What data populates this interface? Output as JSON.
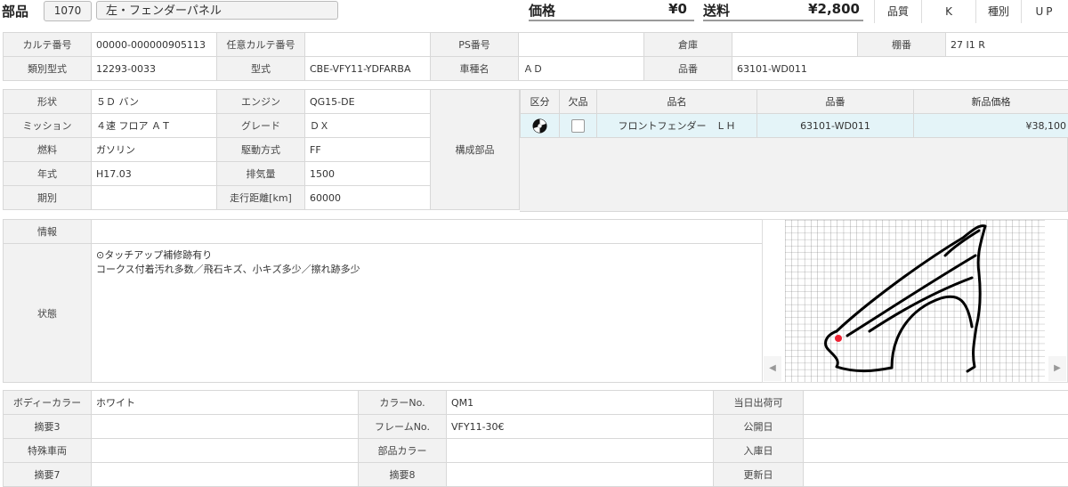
{
  "header": {
    "title": "部品",
    "code": "1070",
    "part_name": "左・フェンダーパネル",
    "price_label": "価格",
    "price_value": "¥0",
    "shipping_label": "送料",
    "shipping_value": "¥2,800",
    "quality_label": "品質",
    "quality_value": "K",
    "type_label": "種別",
    "type_value": "UP"
  },
  "row1": [
    {
      "label": "カルテ番号",
      "value": "00000-000000905113"
    },
    {
      "label": "任意カルテ番号",
      "value": ""
    },
    {
      "label": "PS番号",
      "value": ""
    },
    {
      "label": "倉庫",
      "value": ""
    },
    {
      "label": "棚番",
      "value": "27 I1 R"
    }
  ],
  "row2": [
    {
      "label": "類別型式",
      "value": "12293-0033"
    },
    {
      "label": "型式",
      "value": "CBE-VFY11-YDFARBA"
    },
    {
      "label": "車種名",
      "value": "ＡＤ"
    },
    {
      "label": "品番",
      "value": "63101-WD011"
    }
  ],
  "vehicle": [
    {
      "l1": "形状",
      "v1": "５Ｄ バン",
      "l2": "エンジン",
      "v2": "QG15-DE"
    },
    {
      "l1": "ミッション",
      "v1": "４速 フロア ＡＴ",
      "l2": "グレード",
      "v2": "ＤＸ"
    },
    {
      "l1": "燃料",
      "v1": "ガソリン",
      "l2": "駆動方式",
      "v2": "FF"
    },
    {
      "l1": "年式",
      "v1": "H17.03",
      "l2": "排気量",
      "v2": "1500"
    },
    {
      "l1": "期別",
      "v1": "",
      "l2": "走行距離[km]",
      "v2": "60000"
    }
  ],
  "components_label": "構成部品",
  "parts_table": {
    "headers": [
      "区分",
      "欠品",
      "品名",
      "品番",
      "新品価格"
    ],
    "rows": [
      {
        "category_icon": "disc-icon",
        "missing": false,
        "name": "フロントフェンダー　ＬＨ",
        "number": "63101-WD011",
        "price": "¥38,100"
      }
    ]
  },
  "info": {
    "info_label": "情報",
    "info_value": "",
    "status_label": "状態",
    "status_lines": [
      "⊙タッチアップ補修跡有り",
      "コークス付着汚れ多数／飛石キズ、小キズ多少／擦れ跡多少"
    ]
  },
  "bottom": [
    {
      "l1": "ボディーカラー",
      "v1": "ホワイト",
      "l2": "カラーNo.",
      "v2": "QM1",
      "l3": "当日出荷可",
      "v3": ""
    },
    {
      "l1": "摘要3",
      "v1": "",
      "l2": "フレームNo.",
      "v2": "VFY11-30€",
      "l3": "公開日",
      "v3": ""
    },
    {
      "l1": "特殊車両",
      "v1": "",
      "l2": "部品カラー",
      "v2": "",
      "l3": "入庫日",
      "v3": ""
    },
    {
      "l1": "摘要7",
      "v1": "",
      "l2": "摘要8",
      "v2": "",
      "l3": "更新日",
      "v3": ""
    }
  ],
  "image_nav": {
    "prev": "◀",
    "next": "▶"
  }
}
